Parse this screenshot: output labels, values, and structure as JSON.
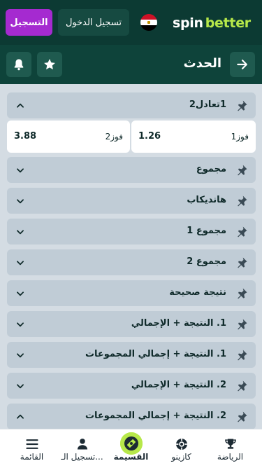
{
  "header": {
    "logo_part1": "spin",
    "logo_part2": "better",
    "login_label": "تسجيل الدخول",
    "register_label": "التسجيل"
  },
  "subheader": {
    "title": "الحدث"
  },
  "markets": [
    {
      "title": "1تعادل2",
      "expanded": true
    },
    {
      "title": "مجموع",
      "expanded": false
    },
    {
      "title": "هانديكاب",
      "expanded": false
    },
    {
      "title": "مجموع 1",
      "expanded": false
    },
    {
      "title": "مجموع 2",
      "expanded": false
    },
    {
      "title": "نتيجة صحيحة",
      "expanded": false
    },
    {
      "title": "1. النتيجة + الإجمالي",
      "expanded": false
    },
    {
      "title": "1. النتيجة + إجمالي المجموعات",
      "expanded": false
    },
    {
      "title": "2. النتيجة + الإجمالي",
      "expanded": false
    },
    {
      "title": "2. النتيجة + إجمالي المجموعات",
      "expanded": true
    }
  ],
  "odds": [
    {
      "name": "فوز1",
      "value": "1.26"
    },
    {
      "name": "فوز2",
      "value": "3.88"
    }
  ],
  "bottom_nav": [
    {
      "label": "القائمة",
      "icon": "menu-icon"
    },
    {
      "label": "تسجيل الـ...",
      "icon": "user-icon"
    },
    {
      "label": "القسيمة",
      "icon": "coupon-icon"
    },
    {
      "label": "كازينو",
      "icon": "casino-chip-icon"
    },
    {
      "label": "الرياضة",
      "icon": "trophy-icon"
    }
  ],
  "colors": {
    "header_bg": "#0c3a33",
    "register_bg": "#a52ad0",
    "accent": "#b7e84a"
  }
}
